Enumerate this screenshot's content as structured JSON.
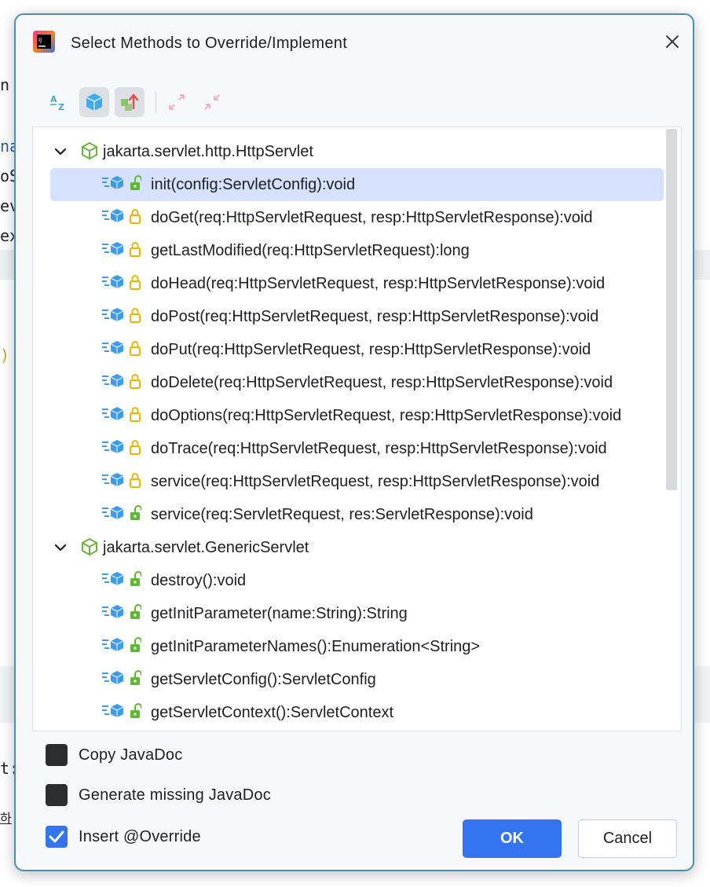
{
  "background": {
    "fragments": [
      "na",
      "oS",
      "ev",
      "ex",
      ")",
      "t:",
      "하"
    ]
  },
  "dialog": {
    "title": "Select Methods to Override/Implement",
    "toolbar": {
      "sort_alpha_label": "AZ"
    },
    "groups": [
      {
        "class_name": "jakarta.servlet.http.HttpServlet",
        "expanded": true,
        "methods": [
          {
            "signature": "init(config:ServletConfig):void",
            "access": "public",
            "selected": true
          },
          {
            "signature": "doGet(req:HttpServletRequest, resp:HttpServletResponse):void",
            "access": "protected",
            "selected": false
          },
          {
            "signature": "getLastModified(req:HttpServletRequest):long",
            "access": "protected",
            "selected": false
          },
          {
            "signature": "doHead(req:HttpServletRequest, resp:HttpServletResponse):void",
            "access": "protected",
            "selected": false
          },
          {
            "signature": "doPost(req:HttpServletRequest, resp:HttpServletResponse):void",
            "access": "protected",
            "selected": false
          },
          {
            "signature": "doPut(req:HttpServletRequest, resp:HttpServletResponse):void",
            "access": "protected",
            "selected": false
          },
          {
            "signature": "doDelete(req:HttpServletRequest, resp:HttpServletResponse):void",
            "access": "protected",
            "selected": false
          },
          {
            "signature": "doOptions(req:HttpServletRequest, resp:HttpServletResponse):void",
            "access": "protected",
            "selected": false
          },
          {
            "signature": "doTrace(req:HttpServletRequest, resp:HttpServletResponse):void",
            "access": "protected",
            "selected": false
          },
          {
            "signature": "service(req:HttpServletRequest, resp:HttpServletResponse):void",
            "access": "protected",
            "selected": false
          },
          {
            "signature": "service(req:ServletRequest, res:ServletResponse):void",
            "access": "public",
            "selected": false
          }
        ]
      },
      {
        "class_name": "jakarta.servlet.GenericServlet",
        "expanded": true,
        "methods": [
          {
            "signature": "destroy():void",
            "access": "public",
            "selected": false
          },
          {
            "signature": "getInitParameter(name:String):String",
            "access": "public",
            "selected": false
          },
          {
            "signature": "getInitParameterNames():Enumeration<String>",
            "access": "public",
            "selected": false
          },
          {
            "signature": "getServletConfig():ServletConfig",
            "access": "public",
            "selected": false
          },
          {
            "signature": "getServletContext():ServletContext",
            "access": "public",
            "selected": false
          }
        ]
      }
    ],
    "options": [
      {
        "label": "Copy JavaDoc",
        "checked": false
      },
      {
        "label": "Generate missing JavaDoc",
        "checked": false
      },
      {
        "label": "Insert @Override",
        "checked": true
      }
    ],
    "buttons": {
      "ok": "OK",
      "cancel": "Cancel"
    }
  },
  "colors": {
    "accent": "#3574f0",
    "selection": "#d5e1ff",
    "public_lock": "#5fb832",
    "protected_lock": "#f0b400",
    "class_icon": "#6db33f",
    "method_icon": "#3d9be9"
  }
}
